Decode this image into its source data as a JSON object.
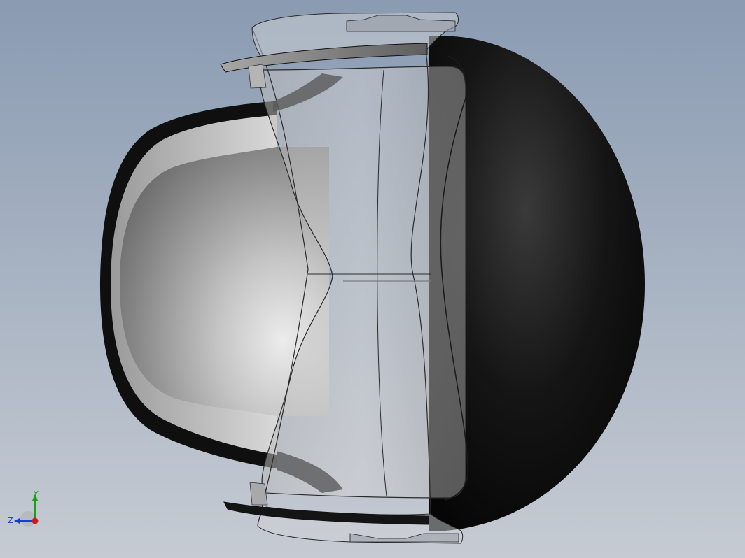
{
  "viewport": {
    "background_top": "#8a9bb2",
    "background_bottom": "#c6cbd3",
    "model": {
      "shell_color": "#0d0d0d",
      "cavity_light": "#e2e2e2",
      "cavity_dark": "#6e6e6e",
      "lens_edge": "#2a2a2a"
    }
  },
  "triad": {
    "y_label": "Y",
    "z_label": "Z",
    "y_color": "#18a018",
    "z_color": "#1a3ad0",
    "x_color": "#d01818"
  }
}
